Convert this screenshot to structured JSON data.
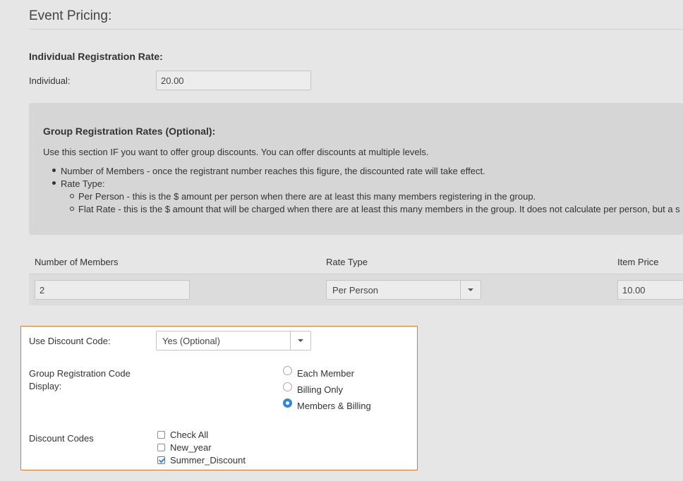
{
  "page": {
    "section_title": "Event Pricing:"
  },
  "individual": {
    "heading": "Individual Registration Rate:",
    "label": "Individual:",
    "value": "20.00"
  },
  "group_info": {
    "heading": "Group Registration Rates (Optional):",
    "intro": "Use this section IF you want to offer group discounts. You can offer discounts at multiple levels.",
    "bullet_members": "Number of Members - once the registrant number reaches this figure, the discounted rate will take effect.",
    "bullet_rate_type": "Rate Type:",
    "sub_per_person": "Per Person - this is the $ amount per person when there are at least this many members registering in the group.",
    "sub_flat_rate": "Flat Rate - this is the $ amount that will be charged when there are at least this many members in the group. It does not calculate per person, but a s"
  },
  "group_table": {
    "headers": [
      "Number of Members",
      "Rate Type",
      "Item Price"
    ],
    "row": {
      "members": "2",
      "rate_type": "Per Person",
      "item_price": "10.00"
    }
  },
  "discount": {
    "use_code_label": "Use Discount Code:",
    "use_code_value": "Yes (Optional)",
    "display_label_line1": "Group Registration Code",
    "display_label_line2": "Display:",
    "display_options": [
      {
        "label": "Each Member",
        "selected": false
      },
      {
        "label": "Billing Only",
        "selected": false
      },
      {
        "label": "Members & Billing",
        "selected": true
      }
    ],
    "codes_label": "Discount Codes",
    "codes": [
      {
        "label": "Check All",
        "checked": false
      },
      {
        "label": "New_year",
        "checked": false
      },
      {
        "label": "Summer_Discount",
        "checked": true
      }
    ]
  },
  "colors": {
    "accent": "#2f86dc",
    "highlight_border": "#e07a2e",
    "background": "#e6e6e6",
    "panel": "#d6d6d6"
  },
  "icons": {
    "dropdown": "caret-down-icon"
  }
}
